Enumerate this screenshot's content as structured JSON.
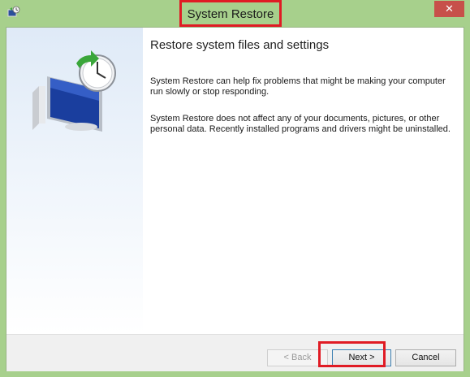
{
  "window": {
    "title": "System Restore",
    "close_label": "✕"
  },
  "content": {
    "heading": "Restore system files and settings",
    "paragraph1": "System Restore can help fix problems that might be making your computer run slowly or stop responding.",
    "paragraph2": "System Restore does not affect any of your documents, pictures, or other personal data. Recently installed programs and drivers might be uninstalled."
  },
  "buttons": {
    "back": "< Back",
    "next": "Next >",
    "cancel": "Cancel"
  },
  "icons": {
    "app": "system-restore-icon",
    "hero": "computer-clock-restore-icon"
  },
  "colors": {
    "titlebar": "#a7d08c",
    "highlight": "#e01b24",
    "close": "#c7504a"
  }
}
